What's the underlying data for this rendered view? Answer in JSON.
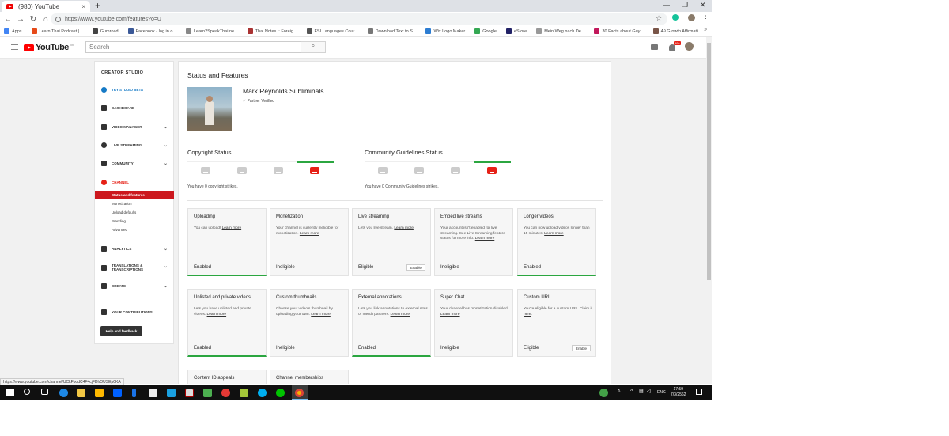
{
  "browser": {
    "tab_title": "(980) YouTube",
    "tab_close": "×",
    "new_tab": "+",
    "url": "https://www.youtube.com/features?o=U",
    "back": "←",
    "forward": "→",
    "reload": "↻",
    "home": "⌂",
    "star": "☆",
    "menu": "⋮",
    "win_min": "—",
    "win_max": "❐",
    "win_close": "✕",
    "bookmarks": [
      {
        "label": "Apps",
        "color": "#4285f4"
      },
      {
        "label": "Learn Thai Podcast |...",
        "color": "#e64a19"
      },
      {
        "label": "Gumroad",
        "color": "#444444"
      },
      {
        "label": "Facebook - log in o...",
        "color": "#3b5998"
      },
      {
        "label": "Learn2SpeakThai ne...",
        "color": "#888888"
      },
      {
        "label": "Thai Notes :: Foreig...",
        "color": "#aa3333"
      },
      {
        "label": "FSI Languages Cour...",
        "color": "#555555"
      },
      {
        "label": "Download Text to S...",
        "color": "#777777"
      },
      {
        "label": "Wix Logo Maker",
        "color": "#2d7dd2"
      },
      {
        "label": "Google",
        "color": "#34a853"
      },
      {
        "label": "eStore",
        "color": "#222266"
      },
      {
        "label": "Mein Weg nach De...",
        "color": "#999999"
      },
      {
        "label": "30 Facts about Guy...",
        "color": "#c2185b"
      },
      {
        "label": "49 Growth Affirmati...",
        "color": "#795548"
      }
    ],
    "bookmarks_more": "»",
    "status_url": "https://www.youtube.com/channel/UCkFbodC4F4cjFDhOUSEp0KA"
  },
  "header": {
    "logo_text": "YouTube",
    "logo_sup": "TM",
    "search_placeholder": "Search",
    "search_icon": "⌕",
    "notif_count": "99+"
  },
  "sidebar": {
    "title": "CREATOR STUDIO",
    "try_beta": "TRY STUDIO BETA",
    "items": [
      {
        "label": "DASHBOARD"
      },
      {
        "label": "VIDEO MANAGER"
      },
      {
        "label": "LIVE STREAMING"
      },
      {
        "label": "COMMUNITY"
      },
      {
        "label": "CHANNEL"
      }
    ],
    "channel_sub": [
      "Status and features",
      "Monetization",
      "Upload defaults",
      "Branding",
      "Advanced"
    ],
    "items2": [
      {
        "label": "ANALYTICS"
      },
      {
        "label": "TRANSLATIONS & TRANSCRIPTIONS"
      },
      {
        "label": "CREATE"
      },
      {
        "label": "YOUR CONTRIBUTIONS"
      }
    ],
    "chevron": "⌄",
    "help_label": "Help and feedback"
  },
  "main": {
    "heading": "Status and Features",
    "channel_name": "Mark Reynolds Subliminals",
    "partner_label": "✓ Partner Verified",
    "copyright_title": "Copyright Status",
    "copyright_strikes": "You have 0 copyright strikes.",
    "community_title": "Community Guidelines Status",
    "community_strikes": "You have 0 Community Guidelines strikes.",
    "learn_more": "Learn more",
    "cards": [
      {
        "title": "Uploading",
        "desc": "You can upload!",
        "status": "Enabled"
      },
      {
        "title": "Monetization",
        "desc": "Your channel is currently ineligible for monetization.",
        "status": "Ineligible"
      },
      {
        "title": "Live streaming",
        "desc": "Lets you live stream.",
        "status": "Eligible",
        "button": "Enable"
      },
      {
        "title": "Embed live streams",
        "desc": "Your account isn't enabled for live streaming. See Live Streaming feature status for more info.",
        "status": "Ineligible"
      },
      {
        "title": "Longer videos",
        "desc": "You can now upload videos longer than 15 minutes!",
        "status": "Enabled"
      },
      {
        "title": "Unlisted and private videos",
        "desc": "Lets you have unlisted and private videos.",
        "status": "Enabled"
      },
      {
        "title": "Custom thumbnails",
        "desc": "Choose your video's thumbnail by uploading your own.",
        "status": "Ineligible"
      },
      {
        "title": "External annotations",
        "desc": "Lets you link annotations to external sites or merch partners.",
        "status": "Enabled"
      },
      {
        "title": "Super Chat",
        "desc": "Your channel has monetization disabled.",
        "status": "Ineligible"
      },
      {
        "title": "Custom URL",
        "desc": "You're eligible for a custom URL. Claim it",
        "link": "here",
        "status": "Eligible",
        "button": "Enable"
      },
      {
        "title": "Content ID appeals",
        "desc": "",
        "status": ""
      },
      {
        "title": "Channel memberships",
        "desc": "",
        "status": ""
      }
    ]
  },
  "taskbar": {
    "lang": "ENG",
    "time": "17:59",
    "date": "7/3/2562"
  },
  "colors": {
    "accent_red": "#e62117",
    "enabled_green": "#2ba640",
    "link_blue": "#167ac6"
  }
}
